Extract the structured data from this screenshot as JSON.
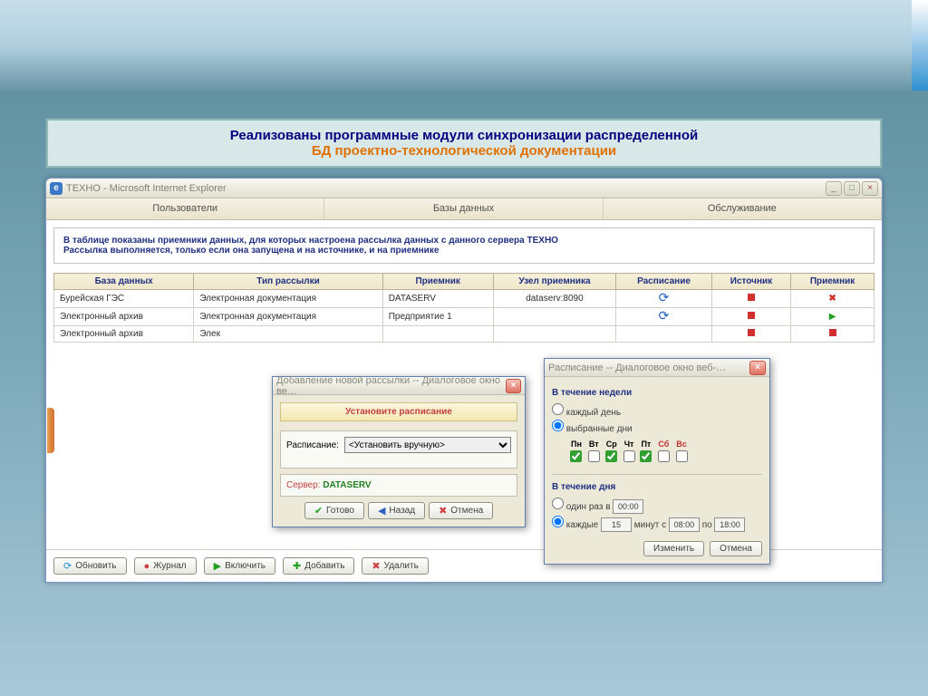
{
  "slide": {
    "line1": "Реализованы программные модули синхронизации распределенной",
    "line2": "БД проектно-технологической документации"
  },
  "browser": {
    "title": "ТЕХНО - Microsoft Internet Explorer",
    "tabs": [
      "Пользователи",
      "Базы данных",
      "Обслуживание"
    ]
  },
  "info": {
    "line1": "В таблице показаны приемники данных, для которых настроена рассылка данных с данного сервера ТЕХНО",
    "line2": "Рассылка выполняется, только если она запущена и на источнике, и на приемнике"
  },
  "table": {
    "headers": [
      "База данных",
      "Тип рассылки",
      "Приемник",
      "Узел приемника",
      "Расписание",
      "Источник",
      "Приемник"
    ],
    "rows": [
      {
        "db": "Бурейская ГЭС",
        "type": "Электронная документация",
        "receiver": "DATASERV",
        "node": "dataserv:8090",
        "sched": "refresh",
        "src": "red",
        "dst": "x"
      },
      {
        "db": "Электронный архив",
        "type": "Электронная документация",
        "receiver": "Предприятие 1",
        "node": "",
        "sched": "refresh",
        "src": "red",
        "dst": "play"
      },
      {
        "db": "Электронный архив",
        "type": "Элек",
        "receiver": "",
        "node": "",
        "sched": "",
        "src": "red",
        "dst": "red"
      }
    ]
  },
  "toolbar": {
    "refresh": "Обновить",
    "log": "Журнал",
    "enable": "Включить",
    "add": "Добавить",
    "delete": "Удалить"
  },
  "dlg_add": {
    "title": "Добавление новой рассылки -- Диалоговое окно ве…",
    "banner": "Установите расписание",
    "sched_label": "Расписание:",
    "sched_value": "<Установить вручную>",
    "server_label": "Сервер:",
    "server_value": "DATASERV",
    "ok": "Готово",
    "back": "Назад",
    "cancel": "Отмена"
  },
  "dlg_sched": {
    "title": "Расписание -- Диалоговое окно веб-…",
    "week_title": "В течение недели",
    "every_day": "каждый день",
    "selected_days": "выбранные дни",
    "days": [
      "Пн",
      "Вт",
      "Ср",
      "Чт",
      "Пт",
      "Сб",
      "Вс"
    ],
    "days_checked": [
      true,
      false,
      true,
      false,
      true,
      false,
      false
    ],
    "day_title": "В течение дня",
    "once_label": "один раз в",
    "once_time": "00:00",
    "every_label_a": "каждые",
    "every_min": "15",
    "every_label_b": "минут с",
    "from_time": "08:00",
    "every_label_c": "по",
    "to_time": "18:00",
    "apply": "Изменить",
    "cancel": "Отмена"
  }
}
